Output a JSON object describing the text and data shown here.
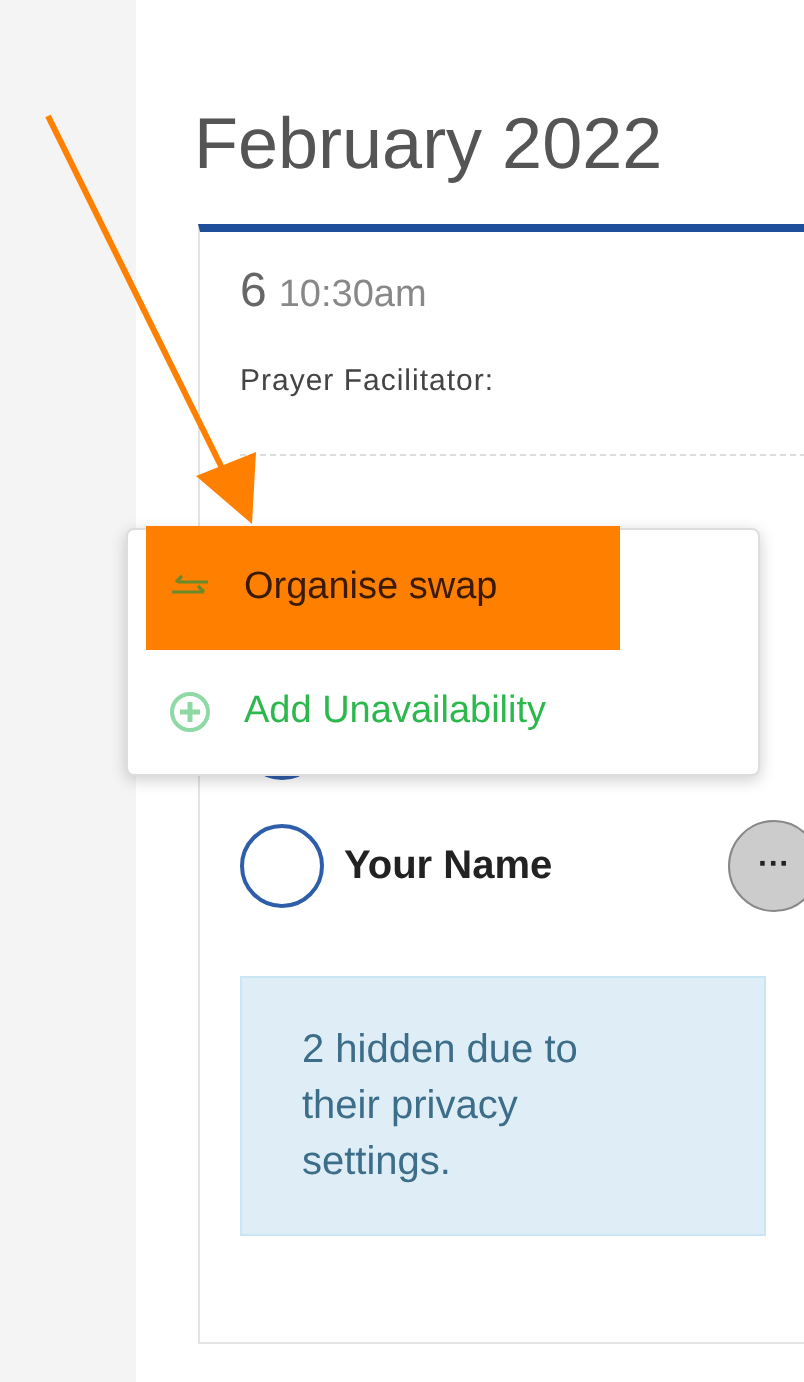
{
  "month_title": "February 2022",
  "event": {
    "day": "6",
    "time": "10:30am",
    "role": "Prayer Facilitator:"
  },
  "members": [
    {
      "kind": "covered"
    },
    {
      "kind": "named",
      "name": "Your Name",
      "more": "···"
    }
  ],
  "notice": "2 hidden due to their privacy settings.",
  "menu": [
    {
      "kind": "swap",
      "label": "Organise swap",
      "highlighted": true
    },
    {
      "kind": "add",
      "label": "Add Unavailability",
      "highlighted": false
    }
  ]
}
